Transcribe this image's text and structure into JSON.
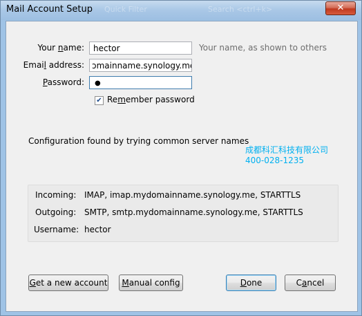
{
  "window": {
    "title": "Mail Account Setup",
    "background_ghost_1": "Quick Filter",
    "background_ghost_2": "Search    <ctrl+k>",
    "close_glyph": "✕"
  },
  "form": {
    "name_label_pre": "Your ",
    "name_label_key": "n",
    "name_label_post": "ame:",
    "name_value": "hector",
    "name_hint": "Your name, as shown to others",
    "email_label_pre": "Emai",
    "email_label_key": "l",
    "email_label_post": " address:",
    "email_value": "ɔmainname.synology.me",
    "password_label_pre": "",
    "password_label_key": "P",
    "password_label_post": "assword:",
    "password_value": "●",
    "remember_pre": "Re",
    "remember_key": "m",
    "remember_post": "ember password",
    "remember_checked": true,
    "remember_glyph": "✔"
  },
  "status": {
    "message": "Configuration found by trying common server names"
  },
  "watermark": {
    "line1": "成都科汇科技有限公司",
    "line2": "400-028-1235"
  },
  "config": {
    "incoming_label": "Incoming:",
    "incoming_value": "IMAP, imap.mydomainname.synology.me, STARTTLS",
    "outgoing_label": "Outgoing:",
    "outgoing_value": "SMTP, smtp.mydomainname.synology.me, STARTTLS",
    "username_label": "Username:",
    "username_value": "hector"
  },
  "buttons": {
    "new_account_key": "G",
    "new_account_rest": "et a new account",
    "manual_key": "M",
    "manual_rest": "anual config",
    "done_key": "D",
    "done_rest": "one",
    "cancel_pre": "C",
    "cancel_key": "a",
    "cancel_post": "ncel"
  },
  "colors": {
    "titlebar": "#a9c7e6",
    "watermark": "#00b0f0",
    "close": "#c0391f"
  }
}
